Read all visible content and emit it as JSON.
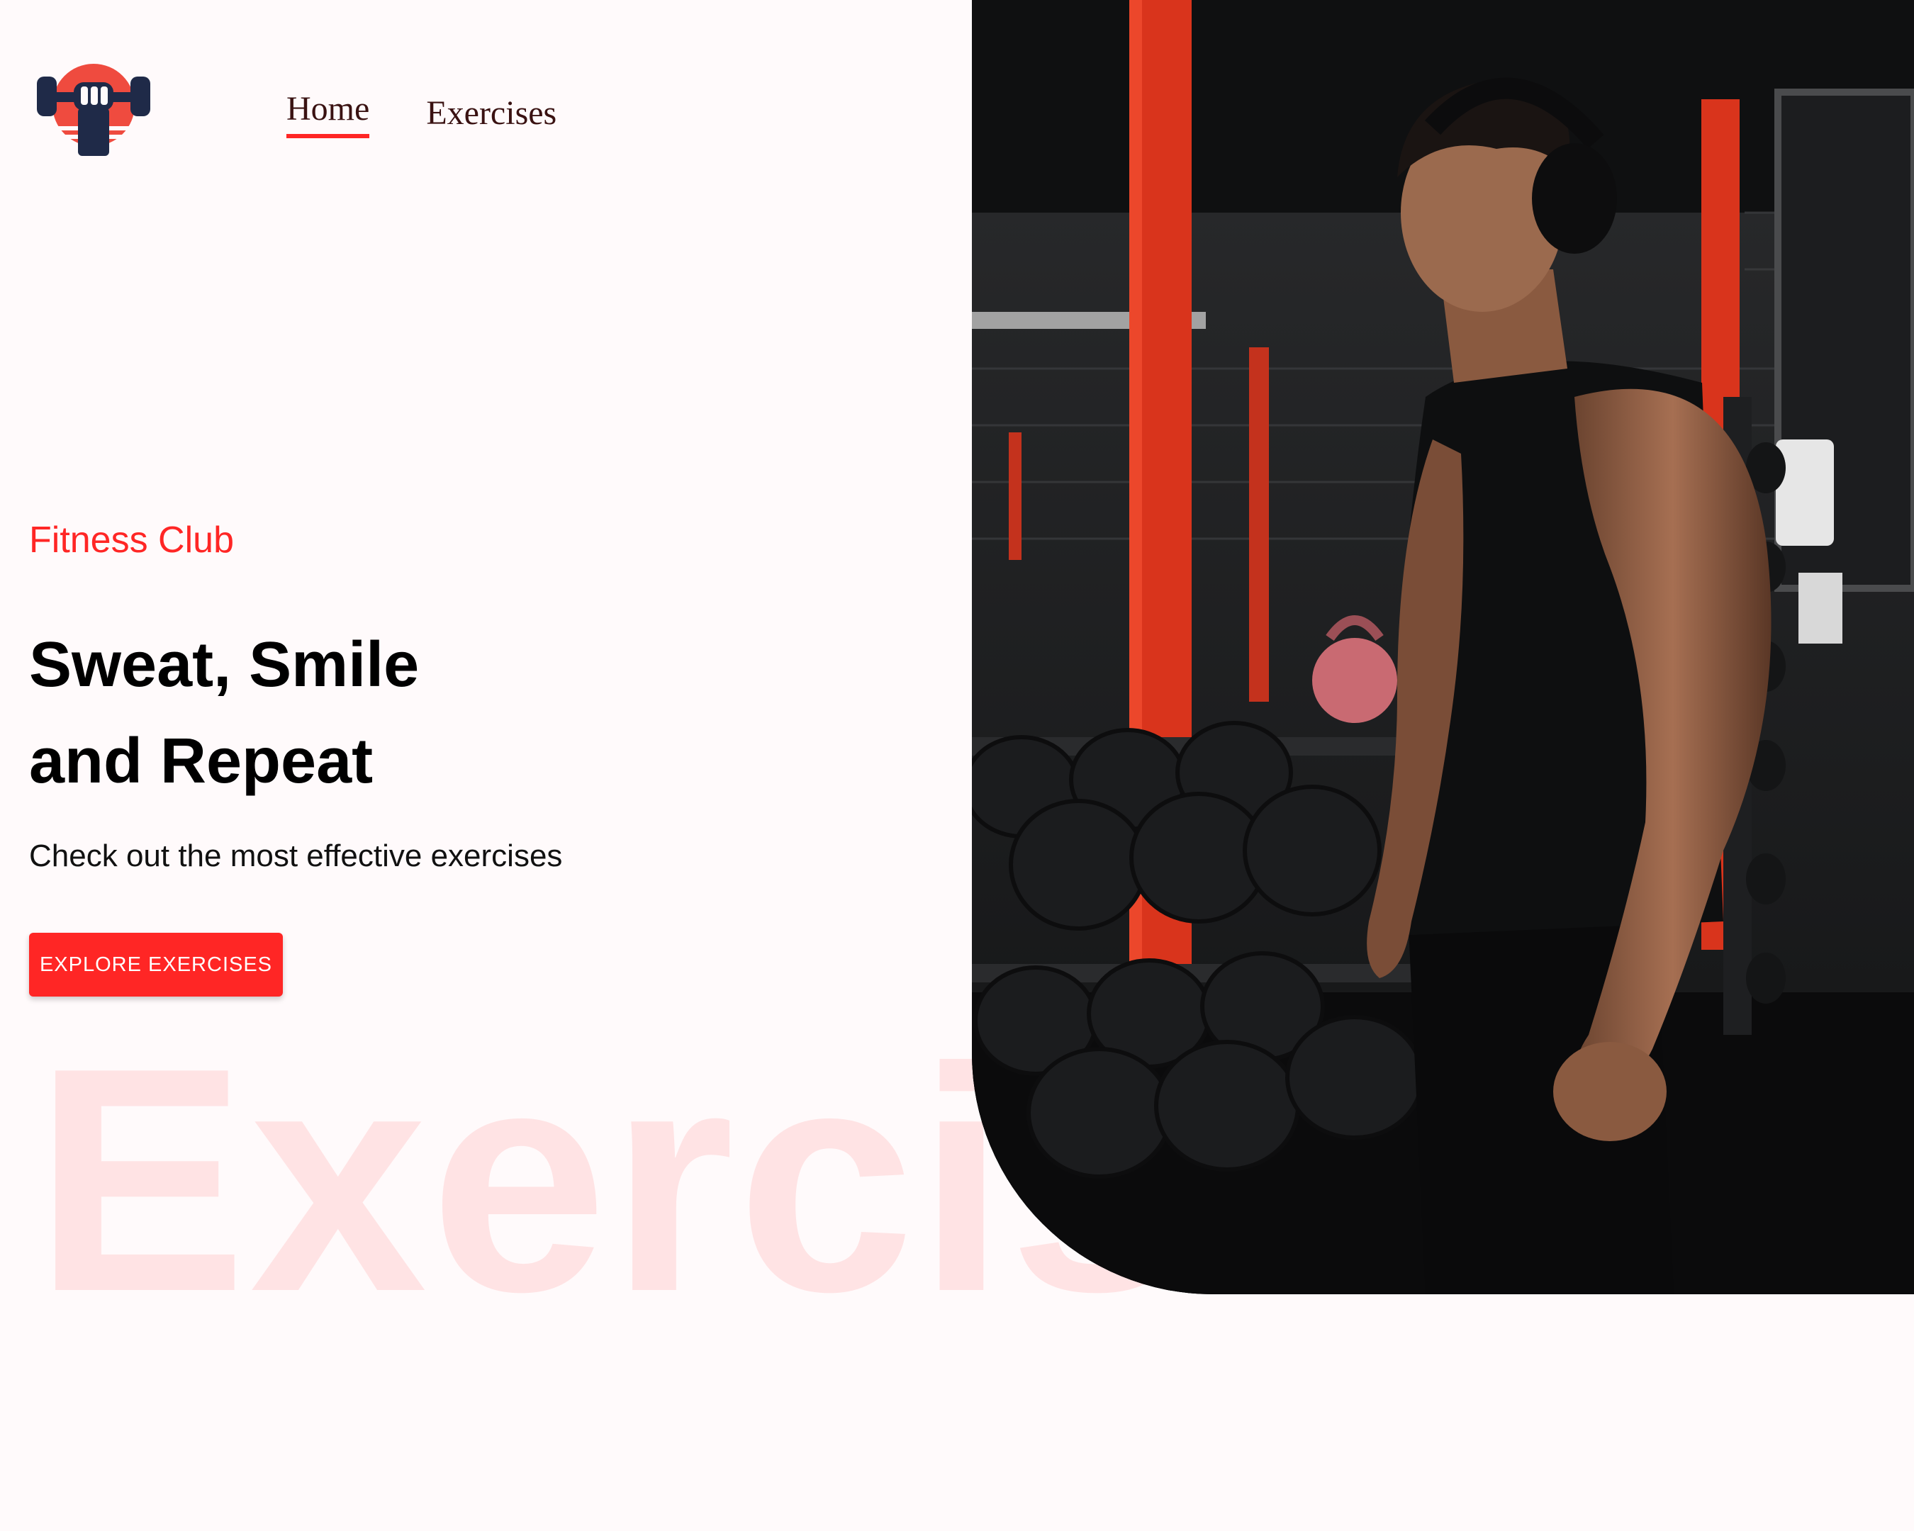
{
  "nav": {
    "home_label": "Home",
    "exercises_label": "Exercises"
  },
  "hero": {
    "kicker": "Fitness Club",
    "title_line1": "Sweat, Smile",
    "title_line2": "and Repeat",
    "subtitle": "Check out the most effective exercises",
    "cta_label": "EXPLORE EXERCISES",
    "watermark": "Exercise"
  },
  "colors": {
    "accent": "#ff2625",
    "background": "#fffafb",
    "nav_text": "#3a1212",
    "logo_navy": "#1f2a48"
  },
  "icons": {
    "logo": "fist-with-dumbbell-logo"
  }
}
